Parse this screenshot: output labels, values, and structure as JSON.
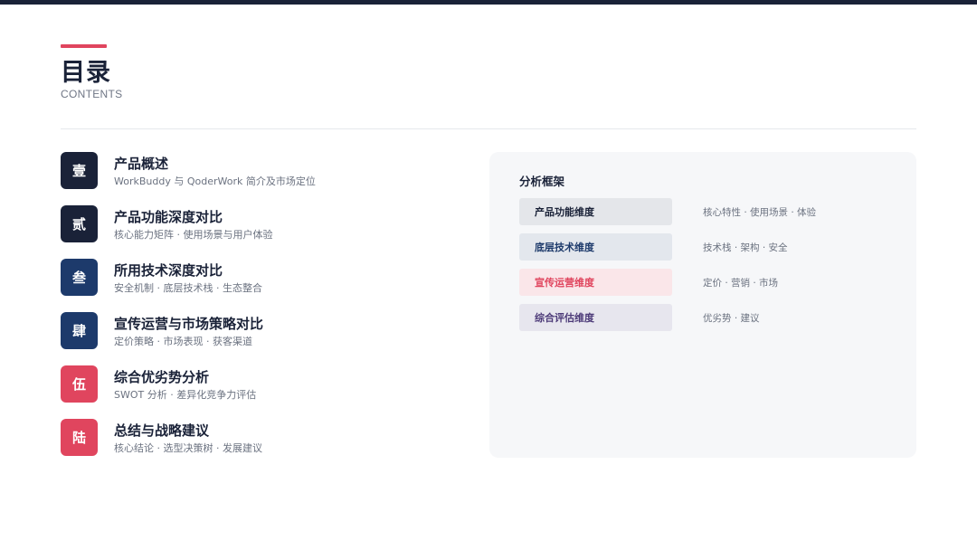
{
  "header": {
    "title": "目录",
    "subtitle": "CONTENTS"
  },
  "toc": {
    "items": [
      {
        "badge": "壹",
        "title": "产品概述",
        "desc": "WorkBuddy 与 QoderWork 简介及市场定位",
        "color": "#1a2238"
      },
      {
        "badge": "贰",
        "title": "产品功能深度对比",
        "desc": "核心能力矩阵 · 使用场景与用户体验",
        "color": "#1a2238"
      },
      {
        "badge": "叁",
        "title": "所用技术深度对比",
        "desc": "安全机制 · 底层技术栈 · 生态整合",
        "color": "#1d3a6b"
      },
      {
        "badge": "肆",
        "title": "宣传运营与市场策略对比",
        "desc": "定价策略 · 市场表现 · 获客渠道",
        "color": "#1d3a6b"
      },
      {
        "badge": "伍",
        "title": "综合优劣势分析",
        "desc": "SWOT 分析 · 差异化竞争力评估",
        "color": "#e0455e"
      },
      {
        "badge": "陆",
        "title": "总结与战略建议",
        "desc": "核心结论 · 选型决策树 · 发展建议",
        "color": "#e0455e"
      }
    ]
  },
  "panel": {
    "title": "分析框架",
    "rows": [
      {
        "label": "产品功能维度",
        "desc": "核心特性 · 使用场景 · 体验",
        "bg": "#e4e6ea",
        "fg": "#1a2238"
      },
      {
        "label": "底层技术维度",
        "desc": "技术栈 · 架构 · 安全",
        "bg": "#e3e7ed",
        "fg": "#1d3a6b"
      },
      {
        "label": "宣传运营维度",
        "desc": "定价 · 营销 · 市场",
        "bg": "#fae6e9",
        "fg": "#e0455e"
      },
      {
        "label": "综合评估维度",
        "desc": "优劣势 · 建议",
        "bg": "#e7e6ee",
        "fg": "#4c3a78"
      }
    ]
  }
}
